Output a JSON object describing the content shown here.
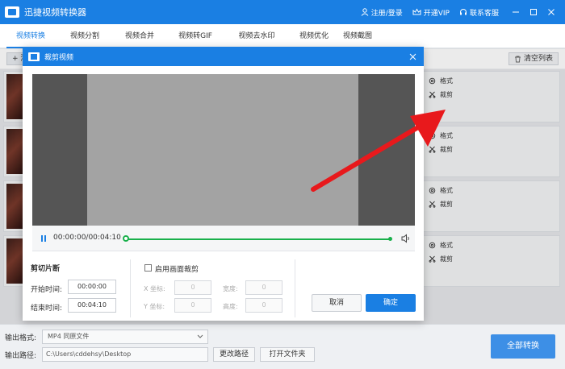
{
  "app": {
    "title": "迅捷视频转换器"
  },
  "titlebar": {
    "login_label": "注册/登录",
    "vip_label": "开通VIP",
    "support_label": "联系客服"
  },
  "tabs": [
    {
      "label": "视频转换",
      "active": true
    },
    {
      "label": "视频分割",
      "active": false
    },
    {
      "label": "视频合并",
      "active": false
    },
    {
      "label": "视频转GIF",
      "active": false
    },
    {
      "label": "视频去水印",
      "active": false
    },
    {
      "label": "视频优化",
      "active": false
    },
    {
      "label": "视频截图",
      "active": false
    }
  ],
  "list_toolbar": {
    "add_label": "+ 添",
    "clear_label": "清空列表"
  },
  "rows": [
    {
      "settings_label": "格式",
      "cut_label": "裁剪"
    },
    {
      "settings_label": "格式",
      "cut_label": "裁剪"
    },
    {
      "settings_label": "格式",
      "cut_label": "裁剪"
    },
    {
      "settings_label": "格式",
      "cut_label": "裁剪"
    }
  ],
  "bottom": {
    "format_label": "输出格式:",
    "format_value": "MP4  同原文件",
    "path_label": "输出路径:",
    "path_value": "C:\\Users\\cddehsy\\Desktop",
    "change_path_label": "更改路径",
    "open_folder_label": "打开文件夹",
    "convert_all_label": "全部转换"
  },
  "dialog": {
    "title": "裁剪视频",
    "time_readout": "00:00:00/00:04:10",
    "clip_section_title": "剪切片断",
    "start_label": "开始时间:",
    "start_value": "00:00:00",
    "end_label": "结束时间:",
    "end_value": "00:04:10",
    "crop_enable_label": "启用画面裁剪",
    "x_label": "X 坐标:",
    "x_value": "0",
    "y_label": "Y 坐标:",
    "y_value": "0",
    "width_label": "宽度:",
    "width_value": "0",
    "height_label": "高度:",
    "height_value": "0",
    "cancel_label": "取消",
    "ok_label": "确定"
  },
  "colors": {
    "brand_blue": "#1a7fe3",
    "timeline_green": "#19b04b",
    "arrow_red": "#e8191c"
  }
}
